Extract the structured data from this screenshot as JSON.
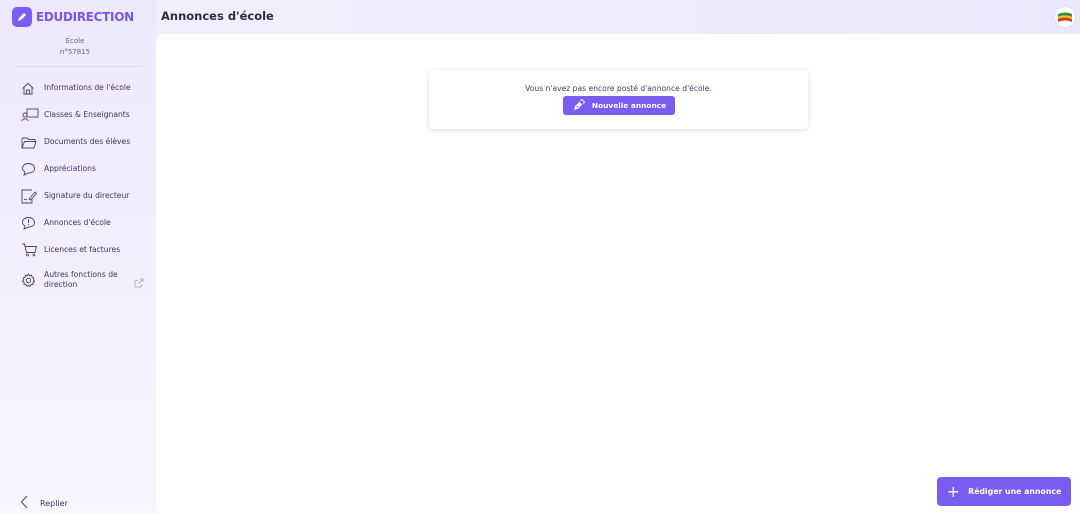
{
  "app": {
    "logo_text": "EDUDIRECTION",
    "page_title": "Annonces d'école"
  },
  "school": {
    "label": "École",
    "number": "n°57815"
  },
  "sidebar": {
    "items": [
      {
        "label": "Informations de l'école",
        "icon": "home-icon"
      },
      {
        "label": "Classes & Enseignants",
        "icon": "teacher-icon"
      },
      {
        "label": "Documents des élèves",
        "icon": "folder-icon"
      },
      {
        "label": "Appréciations",
        "icon": "chat-bubble-icon"
      },
      {
        "label": "Signature du directeur",
        "icon": "signature-icon"
      },
      {
        "label": "Annonces d'école",
        "icon": "announcement-icon"
      },
      {
        "label": "Licences et factures",
        "icon": "cart-icon"
      },
      {
        "label": "Autres fonctions de direction",
        "icon": "gear-icon"
      }
    ],
    "collapse_label": "Replier"
  },
  "main": {
    "empty_message": "Vous n'avez pas encore posté d'annonce d'école.",
    "new_button_label": "Nouvelle annonce",
    "compose_button_label": "Rédiger une annonce"
  },
  "colors": {
    "accent": "#7b5cf0",
    "logo": "#7657ea",
    "sidebar_bg": "#f1ecfe"
  }
}
